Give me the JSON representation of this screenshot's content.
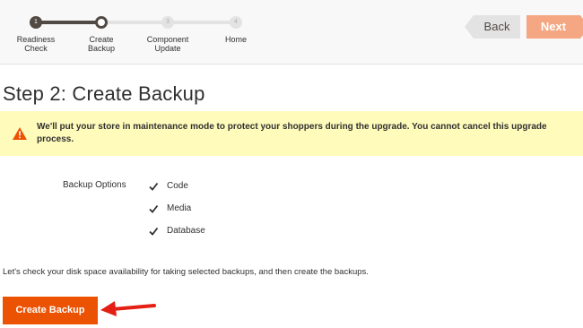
{
  "progress": {
    "steps": [
      {
        "number": "1",
        "label_line1": "Readiness",
        "label_line2": "Check",
        "state": "done"
      },
      {
        "number": "2",
        "label_line1": "Create",
        "label_line2": "Backup",
        "state": "current"
      },
      {
        "number": "3",
        "label_line1": "Component",
        "label_line2": "Update",
        "state": "todo"
      },
      {
        "number": "4",
        "label_line1": "Home",
        "label_line2": "",
        "state": "todo"
      }
    ]
  },
  "nav": {
    "back_label": "Back",
    "next_label": "Next"
  },
  "page": {
    "title": "Step 2: Create Backup"
  },
  "warning": {
    "icon": "warning-icon",
    "text": "We'll put your store in maintenance mode to protect your shoppers during the upgrade. You cannot cancel this upgrade process."
  },
  "backup": {
    "label": "Backup Options",
    "options": [
      {
        "label": "Code",
        "checked": true
      },
      {
        "label": "Media",
        "checked": true
      },
      {
        "label": "Database",
        "checked": true
      }
    ]
  },
  "disk_check_text": "Let's check your disk space availability for taking selected backups, and then create the backups.",
  "create_button_label": "Create Backup",
  "colors": {
    "accent": "#eb5202",
    "next_button": "#f4a782",
    "warning_bg": "#fffbbb",
    "warning_icon": "#eb5202",
    "annotation_arrow": "#e41f14"
  }
}
